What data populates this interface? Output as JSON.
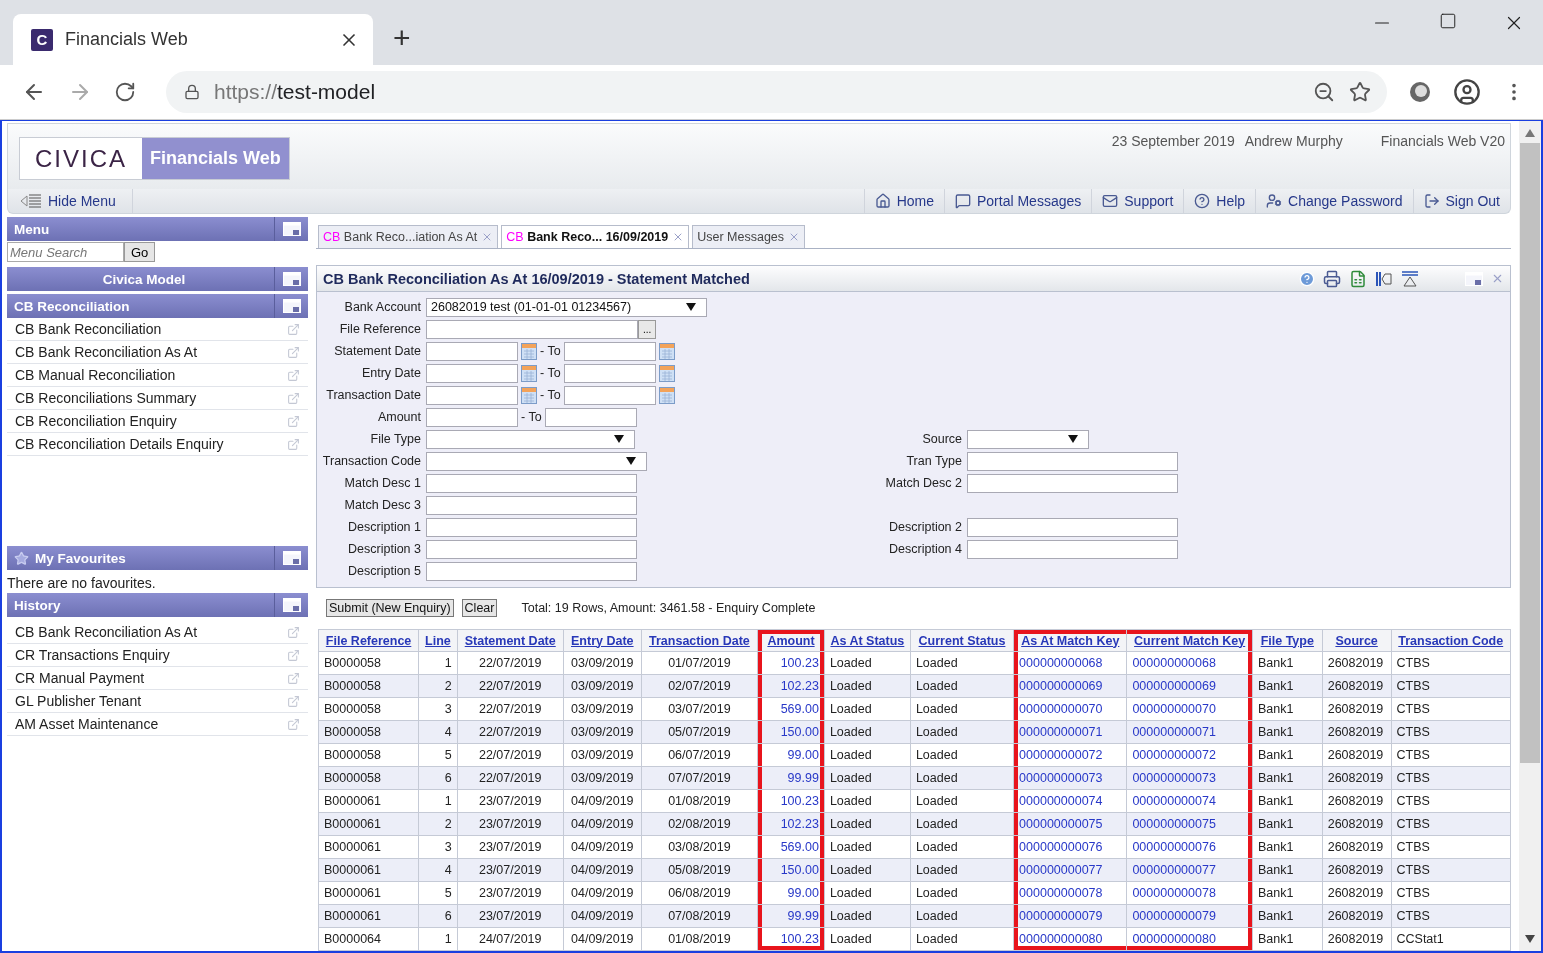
{
  "browser": {
    "tab_title": "Financials Web",
    "favicon": "C",
    "new_tab": "+",
    "url": {
      "scheme": "https://",
      "host": "test-model"
    }
  },
  "header": {
    "logo": "CIVICA",
    "product": "Financials Web",
    "date": "23 September 2019",
    "user": "Andrew Murphy",
    "version": "Financials Web V20"
  },
  "nav": {
    "hide_menu": "Hide Menu",
    "links": [
      "Home",
      "Portal Messages",
      "Support",
      "Help",
      "Change Password",
      "Sign Out"
    ]
  },
  "sidebar": {
    "menu_title": "Menu",
    "search_placeholder": "Menu Search",
    "go": "Go",
    "model_title": "Civica Model",
    "section": {
      "title": "CB Reconciliation",
      "items": [
        "CB Bank Reconciliation",
        "CB Bank Reconciliation As At",
        "CB Manual Reconciliation",
        "CB Reconciliations Summary",
        "CB Reconciliation Enquiry",
        "CB Reconciliation Details Enquiry"
      ]
    },
    "favourites": {
      "title": "My Favourites",
      "empty_text": "There are no favourites."
    },
    "history": {
      "title": "History",
      "items": [
        "CB Bank Reconciliation As At",
        "CR Transactions Enquiry",
        "CR Manual Payment",
        "GL Publisher Tenant",
        "AM Asset Maintenance"
      ]
    }
  },
  "tabs": [
    {
      "module": "CB",
      "label": "Bank Reco...iation As At",
      "selected": false
    },
    {
      "module": "CB",
      "label": "Bank Reco... 16/09/2019",
      "selected": true
    },
    {
      "label": "User Messages",
      "selected": false
    }
  ],
  "panel_title": "CB Bank Reconciliation As At 16/09/2019 - Statement Matched",
  "form": [
    {
      "left": {
        "label": "Bank Account",
        "kind": "select",
        "value": "26082019 test (01-01-01 01234567)"
      }
    },
    {
      "left": {
        "label": "File Reference",
        "kind": "lookup",
        "button": "..."
      }
    },
    {
      "left": {
        "label": "Statement Date",
        "kind": "daterange",
        "separator": "- To"
      }
    },
    {
      "left": {
        "label": "Entry Date",
        "kind": "daterange",
        "separator": "- To"
      }
    },
    {
      "left": {
        "label": "Transaction Date",
        "kind": "daterange",
        "separator": "- To"
      }
    },
    {
      "left": {
        "label": "Amount",
        "kind": "range",
        "separator": "- To"
      }
    },
    {
      "left": {
        "label": "File Type",
        "kind": "select"
      },
      "right": {
        "label": "Source",
        "kind": "select"
      }
    },
    {
      "left": {
        "label": "Transaction Code",
        "kind": "select"
      },
      "right": {
        "label": "Tran Type",
        "kind": "text"
      }
    },
    {
      "left": {
        "label": "Match Desc 1",
        "kind": "text"
      },
      "right": {
        "label": "Match Desc 2",
        "kind": "text"
      }
    },
    {
      "left": {
        "label": "Match Desc 3",
        "kind": "text"
      }
    },
    {
      "left": {
        "label": "Description 1",
        "kind": "text"
      },
      "right": {
        "label": "Description 2",
        "kind": "text"
      }
    },
    {
      "left": {
        "label": "Description 3",
        "kind": "text"
      },
      "right": {
        "label": "Description 4",
        "kind": "text"
      }
    },
    {
      "left": {
        "label": "Description 5",
        "kind": "text"
      }
    }
  ],
  "actions": [
    "Submit (New Enquiry)",
    "Clear"
  ],
  "summary": "Total: 19 Rows, Amount: 3461.58 - Enquiry Complete",
  "table": {
    "columns": [
      {
        "label": "File Reference",
        "kind": "text",
        "highlighted": false
      },
      {
        "label": "Line",
        "kind": "text",
        "highlighted": false
      },
      {
        "label": "Statement Date",
        "kind": "text",
        "highlighted": false
      },
      {
        "label": "Entry Date",
        "kind": "text",
        "highlighted": false
      },
      {
        "label": "Transaction Date",
        "kind": "text",
        "highlighted": false
      },
      {
        "label": "Amount",
        "kind": "link",
        "highlighted": true
      },
      {
        "label": "As At Status",
        "kind": "text",
        "highlighted": false
      },
      {
        "label": "Current Status",
        "kind": "text",
        "highlighted": false
      },
      {
        "label": "As At Match Key",
        "kind": "link",
        "highlighted": true
      },
      {
        "label": "Current Match Key",
        "kind": "link",
        "highlighted": true
      },
      {
        "label": "File Type",
        "kind": "text",
        "highlighted": false
      },
      {
        "label": "Source",
        "kind": "text",
        "highlighted": false
      },
      {
        "label": "Transaction Code",
        "kind": "text",
        "highlighted": false
      }
    ],
    "rows": [
      [
        "B0000058",
        "1",
        "22/07/2019",
        "03/09/2019",
        "01/07/2019",
        "100.23",
        "Loaded",
        "Loaded",
        "000000000068",
        "000000000068",
        "Bank1",
        "26082019",
        "CTBS"
      ],
      [
        "B0000058",
        "2",
        "22/07/2019",
        "03/09/2019",
        "02/07/2019",
        "102.23",
        "Loaded",
        "Loaded",
        "000000000069",
        "000000000069",
        "Bank1",
        "26082019",
        "CTBS"
      ],
      [
        "B0000058",
        "3",
        "22/07/2019",
        "03/09/2019",
        "03/07/2019",
        "569.00",
        "Loaded",
        "Loaded",
        "000000000070",
        "000000000070",
        "Bank1",
        "26082019",
        "CTBS"
      ],
      [
        "B0000058",
        "4",
        "22/07/2019",
        "03/09/2019",
        "05/07/2019",
        "150.00",
        "Loaded",
        "Loaded",
        "000000000071",
        "000000000071",
        "Bank1",
        "26082019",
        "CTBS"
      ],
      [
        "B0000058",
        "5",
        "22/07/2019",
        "03/09/2019",
        "06/07/2019",
        "99.00",
        "Loaded",
        "Loaded",
        "000000000072",
        "000000000072",
        "Bank1",
        "26082019",
        "CTBS"
      ],
      [
        "B0000058",
        "6",
        "22/07/2019",
        "03/09/2019",
        "07/07/2019",
        "99.99",
        "Loaded",
        "Loaded",
        "000000000073",
        "000000000073",
        "Bank1",
        "26082019",
        "CTBS"
      ],
      [
        "B0000061",
        "1",
        "23/07/2019",
        "04/09/2019",
        "01/08/2019",
        "100.23",
        "Loaded",
        "Loaded",
        "000000000074",
        "000000000074",
        "Bank1",
        "26082019",
        "CTBS"
      ],
      [
        "B0000061",
        "2",
        "23/07/2019",
        "04/09/2019",
        "02/08/2019",
        "102.23",
        "Loaded",
        "Loaded",
        "000000000075",
        "000000000075",
        "Bank1",
        "26082019",
        "CTBS"
      ],
      [
        "B0000061",
        "3",
        "23/07/2019",
        "04/09/2019",
        "03/08/2019",
        "569.00",
        "Loaded",
        "Loaded",
        "000000000076",
        "000000000076",
        "Bank1",
        "26082019",
        "CTBS"
      ],
      [
        "B0000061",
        "4",
        "23/07/2019",
        "04/09/2019",
        "05/08/2019",
        "150.00",
        "Loaded",
        "Loaded",
        "000000000077",
        "000000000077",
        "Bank1",
        "26082019",
        "CTBS"
      ],
      [
        "B0000061",
        "5",
        "23/07/2019",
        "04/09/2019",
        "06/08/2019",
        "99.00",
        "Loaded",
        "Loaded",
        "000000000078",
        "000000000078",
        "Bank1",
        "26082019",
        "CTBS"
      ],
      [
        "B0000061",
        "6",
        "23/07/2019",
        "04/09/2019",
        "07/08/2019",
        "99.99",
        "Loaded",
        "Loaded",
        "000000000079",
        "000000000079",
        "Bank1",
        "26082019",
        "CTBS"
      ],
      [
        "B0000064",
        "1",
        "24/07/2019",
        "04/09/2019",
        "01/08/2019",
        "100.23",
        "Loaded",
        "Loaded",
        "000000000080",
        "000000000080",
        "Bank1",
        "26082019",
        "CCStat1"
      ]
    ]
  }
}
